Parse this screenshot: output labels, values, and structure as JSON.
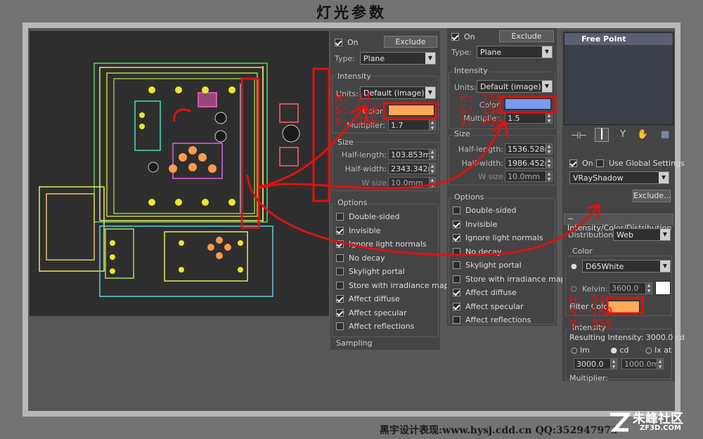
{
  "page_title": "灯光参数",
  "watermark": "黑宇设计表现:www.hysj.cdd.cn QQ:352947973",
  "logo": {
    "main": "朱峰社区",
    "sub": "ZF3D.COM"
  },
  "colors": {
    "orange": "#ffaa5a",
    "blue": "#7a9cf0",
    "red": "#e01010"
  },
  "panel1": {
    "on_label": "On",
    "on_checked": true,
    "exclude_label": "Exclude",
    "type_label": "Type:",
    "type_value": "Plane",
    "intensity_header": "Intensity",
    "units_label": "Units:",
    "units_value": "Default (image)",
    "color_label": "Color:",
    "color_hex": "#ffaa5a",
    "multiplier_label": "Multiplier:",
    "multiplier_value": "1.7",
    "size_header": "Size",
    "half_length_label": "Half-length:",
    "half_length_value": "103.853m",
    "half_width_label": "Half-width:",
    "half_width_value": "2343.342n",
    "w_size_label": "W size",
    "w_size_value": "10.0mm",
    "options_header": "Options",
    "options": [
      {
        "label": "Double-sided",
        "checked": false
      },
      {
        "label": "Invisible",
        "checked": true
      },
      {
        "label": "Ignore light normals",
        "checked": true
      },
      {
        "label": "No decay",
        "checked": false
      },
      {
        "label": "Skylight portal",
        "checked": false
      },
      {
        "label": "Store with irradiance map",
        "checked": false
      },
      {
        "label": "Affect diffuse",
        "checked": true
      },
      {
        "label": "Affect specular",
        "checked": true
      },
      {
        "label": "Affect reflections",
        "checked": false
      }
    ],
    "sampling_header": "Sampling"
  },
  "panel2": {
    "on_label": "On",
    "on_checked": true,
    "exclude_label": "Exclude",
    "type_label": "Type:",
    "type_value": "Plane",
    "intensity_header": "Intensity",
    "units_label": "Units:",
    "units_value": "Default (image)",
    "color_label": "Color:",
    "color_hex": "#7a9cf0",
    "multiplier_label": "Multiplier:",
    "multiplier_value": "1.5",
    "size_header": "Size",
    "half_length_label": "Half-length:",
    "half_length_value": "1536.528r",
    "half_width_label": "Half-width:",
    "half_width_value": "1986.452r",
    "w_size_label": "W size",
    "w_size_value": "10.0mm",
    "options_header": "Options",
    "options": [
      {
        "label": "Double-sided",
        "checked": false
      },
      {
        "label": "Invisible",
        "checked": true
      },
      {
        "label": "Ignore light normals",
        "checked": true
      },
      {
        "label": "No decay",
        "checked": false
      },
      {
        "label": "Skylight portal",
        "checked": false
      },
      {
        "label": "Store with irradiance map",
        "checked": false
      },
      {
        "label": "Affect diffuse",
        "checked": true
      },
      {
        "label": "Affect specular",
        "checked": true
      },
      {
        "label": "Affect reflections",
        "checked": false
      }
    ]
  },
  "panel3": {
    "list_item": "Free Point",
    "on_label": "On",
    "on_checked": true,
    "global_label": "Use Global Settings",
    "global_checked": false,
    "shadow_value": "VRayShadow",
    "exclude_label": "Exclude...",
    "rollout_title": "Intensity/Color/Distribution",
    "distribution_label": "Distribution:",
    "distribution_value": "Web",
    "color_header": "Color",
    "color_value": "D65White",
    "kelvin_label": "Kelvin:",
    "kelvin_value": "3600.0",
    "filter_label": "Filter Color:",
    "filter_hex": "#ffaa5a",
    "intensity_header": "Intensity",
    "resulting_label": "Resulting Intensity: 3000.0 cd",
    "radio_lm": "lm",
    "radio_cd": "cd",
    "radio_lx": "lx at",
    "cd_value": "3000.0",
    "dist_value": "1000.0mr",
    "multiplier_label": "Multiplier:"
  },
  "annotations": {
    "hsv1": [
      "H: 24",
      "S: 160",
      "V: 255"
    ],
    "hsv2": [
      "H: 155",
      "S: 150",
      "V: 255"
    ],
    "hsv3": [
      "H: 24",
      "S: 160",
      "V: 255"
    ]
  }
}
